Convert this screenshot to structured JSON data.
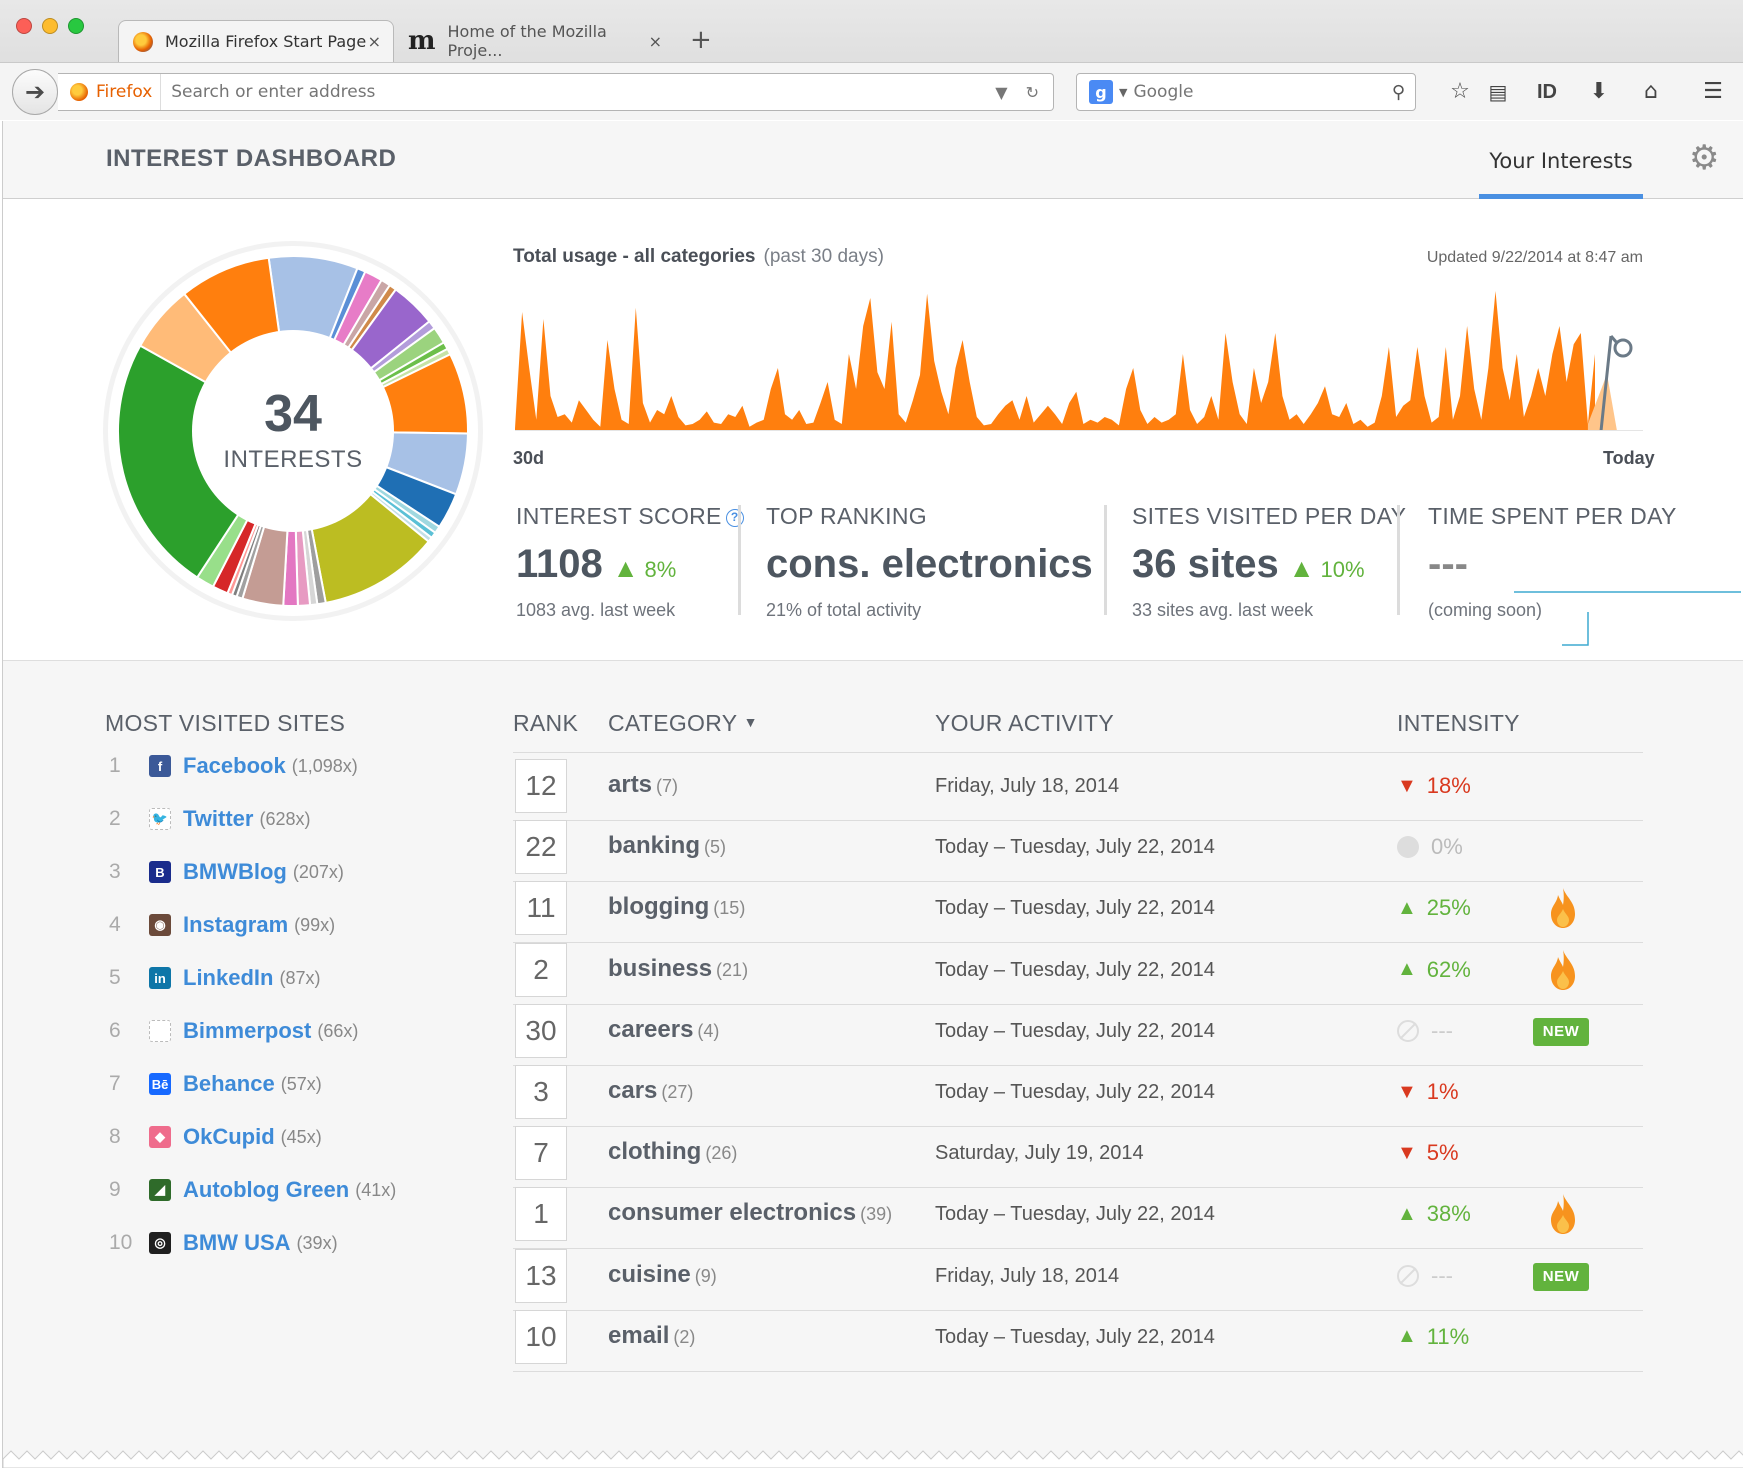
{
  "browser": {
    "tabs": [
      {
        "title": "Mozilla Firefox Start Page",
        "close": "×"
      },
      {
        "title": "Home of the Mozilla Proje...",
        "close": "×"
      }
    ],
    "new_tab": "+",
    "identity_label": "Firefox",
    "url_placeholder": "Search or enter address",
    "search_engine": "Google",
    "toolbar_text_button": "ID"
  },
  "header": {
    "title": "INTEREST DASHBOARD",
    "tab_label": "Your Interests"
  },
  "donut": {
    "count": "34",
    "label": "INTERESTS",
    "segments": [
      {
        "color": "#a7c1e6",
        "value": 7.4
      },
      {
        "color": "#5b8fd6",
        "value": 0.7
      },
      {
        "color": "#e77cc7",
        "value": 1.5
      },
      {
        "color": "#c9a6a6",
        "value": 0.8
      },
      {
        "color": "#d08a4a",
        "value": 0.6
      },
      {
        "color": "#9966cc",
        "value": 3.8
      },
      {
        "color": "#b39ddb",
        "value": 0.7
      },
      {
        "color": "#9bd37e",
        "value": 1.4
      },
      {
        "color": "#6cbf4a",
        "value": 0.6
      },
      {
        "color": "#c6e3a6",
        "value": 0.5
      },
      {
        "color": "#ff7f0e",
        "value": 6.7
      },
      {
        "color": "#a7c1e6",
        "value": 5.1
      },
      {
        "color": "#1f6fb4",
        "value": 3.0
      },
      {
        "color": "#9fd8e0",
        "value": 0.6
      },
      {
        "color": "#5bc0d6",
        "value": 0.5
      },
      {
        "color": "#c3dfe6",
        "value": 0.4
      },
      {
        "color": "#bcbd22",
        "value": 10.0
      },
      {
        "color": "#9e9e9e",
        "value": 0.7
      },
      {
        "color": "#d6d6d6",
        "value": 0.6
      },
      {
        "color": "#e79ac2",
        "value": 1.0
      },
      {
        "color": "#e377c2",
        "value": 1.2
      },
      {
        "color": "#c49c94",
        "value": 3.4
      },
      {
        "color": "#a1a1a1",
        "value": 0.5
      },
      {
        "color": "#7f7f7f",
        "value": 0.4
      },
      {
        "color": "#ff9896",
        "value": 0.4
      },
      {
        "color": "#d62728",
        "value": 1.3
      },
      {
        "color": "#98df8a",
        "value": 1.5
      },
      {
        "color": "#2ca02c",
        "value": 21.5
      },
      {
        "color": "#ffbb78",
        "value": 5.6
      },
      {
        "color": "#ff7f0e",
        "value": 7.6
      }
    ]
  },
  "usage": {
    "title": "Total usage - all categories",
    "subtitle": "(past 30 days)",
    "updated": "Updated 9/22/2014 at 8:47 am",
    "x_start": "30d",
    "x_end": "Today"
  },
  "stats": {
    "interest_score": {
      "label": "INTEREST SCORE",
      "value": "1108",
      "change": "8%",
      "sub": "1083 avg. last week"
    },
    "top_ranking": {
      "label": "TOP RANKING",
      "value": "cons. electronics",
      "sub": "21% of total activity"
    },
    "sites_per_day": {
      "label": "SITES VISITED PER DAY",
      "value": "36 sites",
      "change": "10%",
      "sub": "33 sites avg. last week"
    },
    "time_per_day": {
      "label": "TIME SPENT PER DAY",
      "value": "---",
      "sub": "(coming soon)"
    }
  },
  "most_visited": {
    "title": "MOST VISITED SITES",
    "sites": [
      {
        "rank": "1",
        "name": "Facebook",
        "count": "(1,098x)",
        "icon": "facebook-icon",
        "color": "#3b5998",
        "glyph": "f"
      },
      {
        "rank": "2",
        "name": "Twitter",
        "count": "(628x)",
        "icon": "twitter-icon",
        "color": "#ffffff",
        "glyph": "🐦"
      },
      {
        "rank": "3",
        "name": "BMWBlog",
        "count": "(207x)",
        "icon": "bmwblog-icon",
        "color": "#1a2c8c",
        "glyph": "B"
      },
      {
        "rank": "4",
        "name": "Instagram",
        "count": "(99x)",
        "icon": "instagram-icon",
        "color": "#6b4a3a",
        "glyph": "◉"
      },
      {
        "rank": "5",
        "name": "LinkedIn",
        "count": "(87x)",
        "icon": "linkedin-icon",
        "color": "#0e76a8",
        "glyph": "in"
      },
      {
        "rank": "6",
        "name": "Bimmerpost",
        "count": "(66x)",
        "icon": "bimmerpost-icon",
        "color": "#ffffff",
        "glyph": ""
      },
      {
        "rank": "7",
        "name": "Behance",
        "count": "(57x)",
        "icon": "behance-icon",
        "color": "#1769ff",
        "glyph": "Bē"
      },
      {
        "rank": "8",
        "name": "OkCupid",
        "count": "(45x)",
        "icon": "okcupid-icon",
        "color": "#ef6c8c",
        "glyph": "◆"
      },
      {
        "rank": "9",
        "name": "Autoblog Green",
        "count": "(41x)",
        "icon": "autoblog-green-icon",
        "color": "#2f6b2a",
        "glyph": "◢"
      },
      {
        "rank": "10",
        "name": "BMW USA",
        "count": "(39x)",
        "icon": "bmw-usa-icon",
        "color": "#1f1f1f",
        "glyph": "◎"
      }
    ]
  },
  "table": {
    "headers": {
      "rank": "RANK",
      "category": "CATEGORY",
      "activity": "YOUR ACTIVITY",
      "intensity": "INTENSITY"
    },
    "new_label": "NEW",
    "rows": [
      {
        "rank": "12",
        "category": "arts",
        "count": "(7)",
        "activity": "Friday, July 18, 2014",
        "trend": "down",
        "intensity": "18%",
        "hot": false,
        "new": false
      },
      {
        "rank": "22",
        "category": "banking",
        "count": "(5)",
        "activity": "Today – Tuesday, July 22, 2014",
        "trend": "flat",
        "intensity": "0%",
        "hot": false,
        "new": false
      },
      {
        "rank": "11",
        "category": "blogging",
        "count": "(15)",
        "activity": "Today – Tuesday, July 22, 2014",
        "trend": "up",
        "intensity": "25%",
        "hot": true,
        "new": false
      },
      {
        "rank": "2",
        "category": "business",
        "count": "(21)",
        "activity": "Today – Tuesday, July 22, 2014",
        "trend": "up",
        "intensity": "62%",
        "hot": true,
        "new": false
      },
      {
        "rank": "30",
        "category": "careers",
        "count": "(4)",
        "activity": "Today – Tuesday, July 22, 2014",
        "trend": "none",
        "intensity": "---",
        "hot": false,
        "new": true
      },
      {
        "rank": "3",
        "category": "cars",
        "count": "(27)",
        "activity": "Today – Tuesday, July 22, 2014",
        "trend": "down",
        "intensity": "1%",
        "hot": false,
        "new": false
      },
      {
        "rank": "7",
        "category": "clothing",
        "count": "(26)",
        "activity": "Saturday, July 19, 2014",
        "trend": "down",
        "intensity": "5%",
        "hot": false,
        "new": false
      },
      {
        "rank": "1",
        "category": "consumer electronics",
        "count": "(39)",
        "activity": "Today – Tuesday, July 22, 2014",
        "trend": "up",
        "intensity": "38%",
        "hot": true,
        "new": false
      },
      {
        "rank": "13",
        "category": "cuisine",
        "count": "(9)",
        "activity": "Friday, July 18, 2014",
        "trend": "none",
        "intensity": "---",
        "hot": false,
        "new": true
      },
      {
        "rank": "10",
        "category": "email",
        "count": "(2)",
        "activity": "Today – Tuesday, July 22, 2014",
        "trend": "up",
        "intensity": "11%",
        "hot": false,
        "new": false
      }
    ]
  },
  "chart_data": {
    "type": "area",
    "title": "Total usage - all categories",
    "subtitle": "(past 30 days)",
    "xlabel": "",
    "ylabel": "",
    "x_tick_labels": [
      "30d",
      "Today"
    ],
    "values": [
      2,
      85,
      45,
      8,
      80,
      25,
      10,
      12,
      6,
      22,
      15,
      8,
      3,
      65,
      30,
      8,
      5,
      88,
      20,
      6,
      15,
      12,
      25,
      10,
      4,
      5,
      8,
      14,
      6,
      5,
      12,
      10,
      18,
      3,
      6,
      8,
      30,
      45,
      12,
      8,
      15,
      5,
      6,
      20,
      35,
      8,
      5,
      55,
      30,
      75,
      95,
      42,
      30,
      78,
      12,
      6,
      22,
      40,
      98,
      50,
      28,
      12,
      45,
      65,
      35,
      10,
      4,
      5,
      12,
      18,
      22,
      8,
      25,
      6,
      12,
      18,
      12,
      5,
      20,
      28,
      5,
      8,
      6,
      10,
      8,
      4,
      30,
      45,
      15,
      5,
      10,
      6,
      8,
      12,
      55,
      15,
      5,
      10,
      25,
      8,
      70,
      35,
      12,
      5,
      45,
      20,
      35,
      70,
      25,
      8,
      12,
      5,
      12,
      20,
      32,
      12,
      10,
      20,
      5,
      8,
      3,
      6,
      25,
      60,
      10,
      18,
      22,
      60,
      25,
      6,
      10,
      60,
      8,
      25,
      75,
      30,
      8,
      45,
      100,
      45,
      22,
      55,
      10,
      25,
      45,
      25,
      55,
      75,
      35,
      62,
      70,
      5,
      55
    ],
    "ylim": [
      0,
      100
    ],
    "grid": false,
    "colors": {
      "fill": "#ff7f0e",
      "highlight": "#ffc58a",
      "marker": "#6b7a87"
    }
  }
}
